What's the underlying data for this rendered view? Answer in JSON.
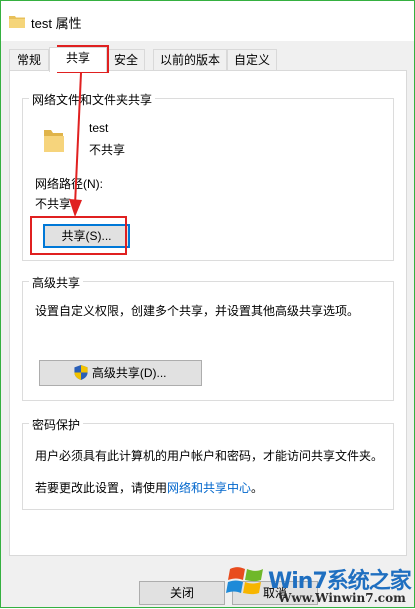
{
  "window": {
    "title": "test 属性"
  },
  "tabs": [
    {
      "label": "常规"
    },
    {
      "label": "共享"
    },
    {
      "label": "安全"
    },
    {
      "label": "以前的版本"
    },
    {
      "label": "自定义"
    }
  ],
  "network_sharing": {
    "group_title": "网络文件和文件夹共享",
    "item_name": "test",
    "item_status": "不共享",
    "path_label": "网络路径(N):",
    "path_value": "不共享",
    "share_button": "共享(S)..."
  },
  "advanced_sharing": {
    "group_title": "高级共享",
    "description": "设置自定义权限，创建多个共享，并设置其他高级共享选项。",
    "button": "高级共享(D)..."
  },
  "password_protection": {
    "group_title": "密码保护",
    "description": "用户必须具有此计算机的用户帐户和密码，才能访问共享文件夹。",
    "change_prefix": "若要更改此设置，请使用",
    "change_link": "网络和共享中心",
    "change_suffix": "。"
  },
  "footer": {
    "close_button": "关闭",
    "cancel_button": "取消"
  },
  "watermark": {
    "brand": "Win7系统之家",
    "url": "Www.Winwin7.com"
  },
  "colors": {
    "accent": "#0078d7",
    "annotation": "#e02020",
    "link": "#0066cc",
    "window_border": "#35b040"
  }
}
